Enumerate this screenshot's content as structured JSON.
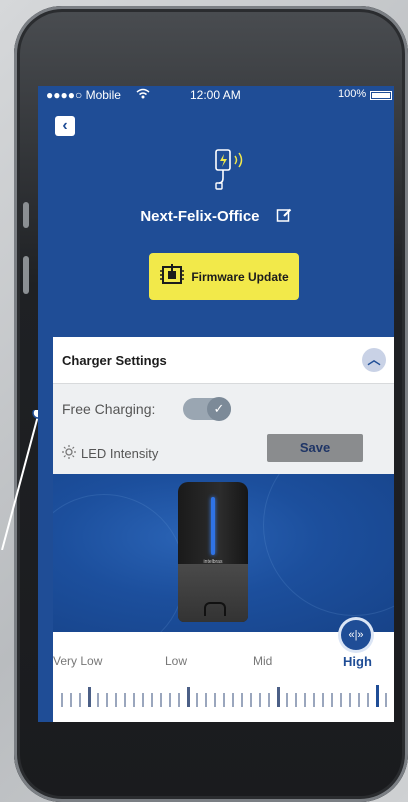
{
  "status_bar": {
    "carrier": "●●●●○ Mobile",
    "time": "12:00 AM",
    "battery": "100%"
  },
  "device": {
    "name": "Next-Felix-Office",
    "firmware_button": "Firmware Update"
  },
  "settings": {
    "title": "Charger Settings",
    "free_charging_label": "Free Charging:",
    "free_charging_enabled": true,
    "led_label": "LED Intensity",
    "save_label": "Save",
    "charger_brand": "intelbras",
    "levels": [
      "Very Low",
      "Low",
      "Mid",
      "High"
    ],
    "selected_level": "High"
  },
  "colors": {
    "screen_bg": "#1f4d96",
    "accent_yellow": "#f2e94a",
    "save_gray": "#8a8c8e"
  },
  "icons": [
    "back-icon",
    "ev-charger-icon",
    "edit-icon",
    "firmware-icon",
    "chevron-up-icon",
    "check-icon",
    "brightness-icon",
    "slider-thumb-icon"
  ]
}
